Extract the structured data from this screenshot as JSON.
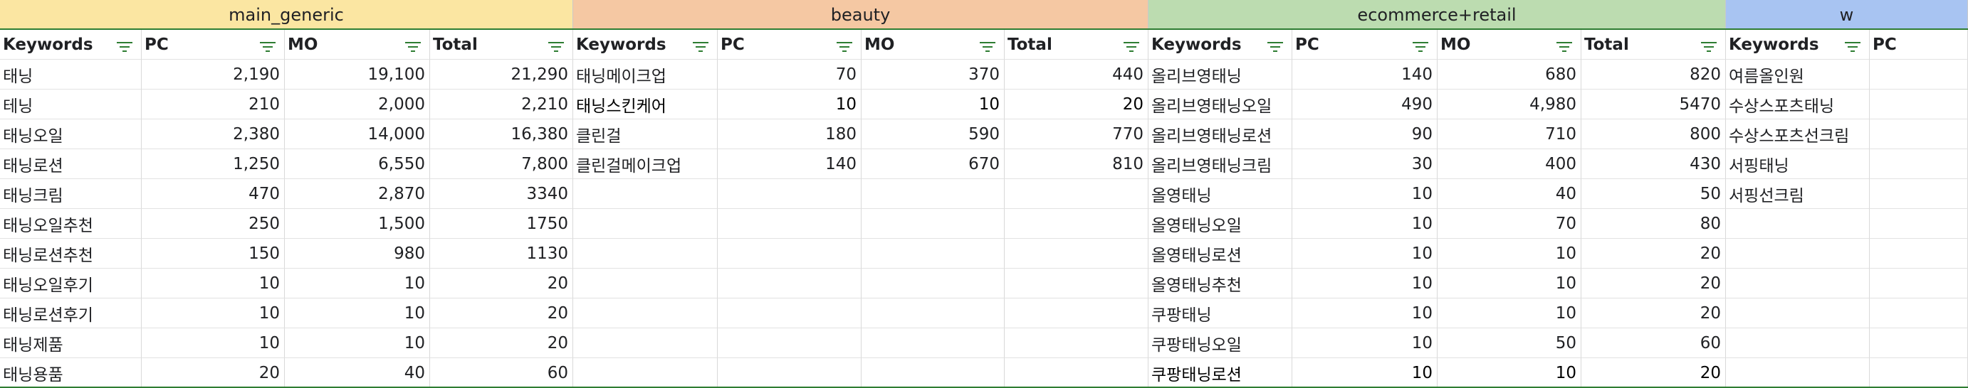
{
  "groups": [
    {
      "name": "main_generic",
      "color": "#fbe6a2"
    },
    {
      "name": "beauty",
      "color": "#f5c8a3"
    },
    {
      "name": "ecommerce+retail",
      "color": "#bcdcb0"
    },
    {
      "name": "w",
      "color": "#a8c4f2"
    }
  ],
  "column_headers": [
    "Keywords",
    "PC",
    "MO",
    "Total",
    "Keywords",
    "PC",
    "MO",
    "Total",
    "Keywords",
    "PC",
    "MO",
    "Total",
    "Keywords",
    "PC"
  ],
  "sections": [
    {
      "rows": [
        [
          "태닝",
          "2,190",
          "19,100",
          "21,290"
        ],
        [
          "테닝",
          "210",
          "2,000",
          "2,210"
        ],
        [
          "태닝오일",
          "2,380",
          "14,000",
          "16,380"
        ],
        [
          "태닝로션",
          "1,250",
          "6,550",
          "7,800"
        ],
        [
          "태닝크림",
          "470",
          "2,870",
          "3340"
        ],
        [
          "태닝오일추천",
          "250",
          "1,500",
          "1750"
        ],
        [
          "태닝로션추천",
          "150",
          "980",
          "1130"
        ],
        [
          "태닝오일후기",
          "10",
          "10",
          "20"
        ],
        [
          "태닝로션후기",
          "10",
          "10",
          "20"
        ],
        [
          "태닝제품",
          "10",
          "10",
          "20"
        ],
        [
          "태닝용품",
          "20",
          "40",
          "60"
        ]
      ]
    },
    {
      "rows": [
        [
          "태닝메이크업",
          "70",
          "370",
          "440"
        ],
        [
          "태닝스킨케어",
          "10",
          "10",
          "20"
        ],
        [
          "클린걸",
          "180",
          "590",
          "770"
        ],
        [
          "클린걸메이크업",
          "140",
          "670",
          "810"
        ]
      ]
    },
    {
      "rows": [
        [
          "올리브영태닝",
          "140",
          "680",
          "820"
        ],
        [
          "올리브영태닝오일",
          "490",
          "4,980",
          "5470"
        ],
        [
          "올리브영태닝로션",
          "90",
          "710",
          "800"
        ],
        [
          "올리브영태닝크림",
          "30",
          "400",
          "430"
        ],
        [
          "올영태닝",
          "10",
          "40",
          "50"
        ],
        [
          "올영태닝오일",
          "10",
          "70",
          "80"
        ],
        [
          "올영태닝로션",
          "10",
          "10",
          "20"
        ],
        [
          "올영태닝추천",
          "10",
          "10",
          "20"
        ],
        [
          "쿠팡태닝",
          "10",
          "10",
          "20"
        ],
        [
          "쿠팡태닝오일",
          "10",
          "50",
          "60"
        ],
        [
          "쿠팡태닝로션",
          "10",
          "10",
          "20"
        ]
      ]
    },
    {
      "rows": [
        [
          "여름올인원",
          ""
        ],
        [
          "수상스포츠태닝",
          ""
        ],
        [
          "수상스포츠선크림",
          ""
        ],
        [
          "서핑태닝",
          ""
        ],
        [
          "서핑선크림",
          ""
        ]
      ]
    }
  ]
}
